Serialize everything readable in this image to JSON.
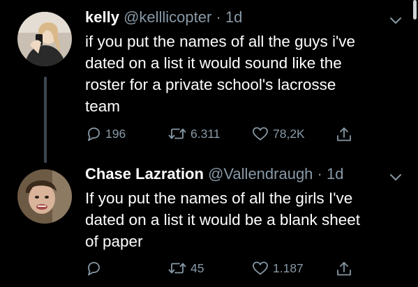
{
  "colors": {
    "background": "#000000",
    "text": "#ffffff",
    "muted": "#8899a6",
    "thread_line": "#3d4650"
  },
  "tweets": [
    {
      "name": "kelly",
      "handle": "@kelllicopter",
      "time": "· 1d",
      "text": "if you put the names of all the guys i've\ndated on a list it would sound like the\nroster for a private school's lacrosse\nteam",
      "replies": "196",
      "retweets": "6.311",
      "likes": "78,2K",
      "avatar_icon": "user-avatar-photo"
    },
    {
      "name": "Chase Lazration",
      "handle": "@Vallendraugh",
      "time": "· 1d",
      "text": "If you put the names of all the girls I've\ndated on a list it would be a blank sheet\nof paper",
      "replies": "",
      "retweets": "45",
      "likes": "1.187",
      "avatar_icon": "user-avatar-photo"
    }
  ]
}
